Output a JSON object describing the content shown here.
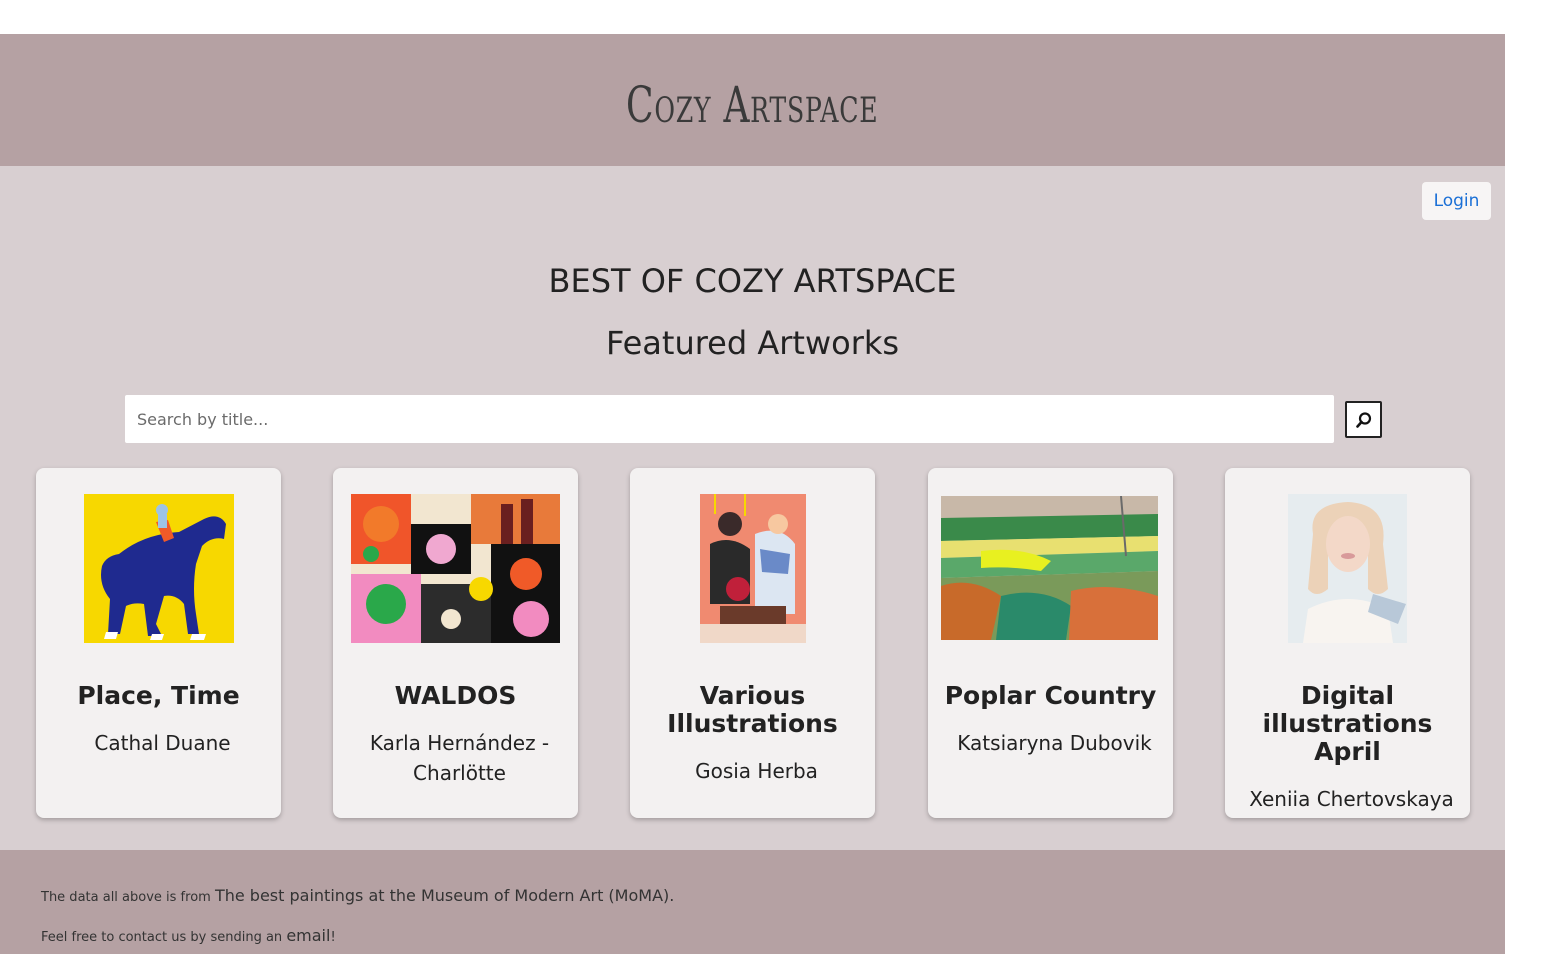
{
  "header": {
    "brand": "Cozy Artspace"
  },
  "nav": {
    "login_label": "Login"
  },
  "main": {
    "heading": "BEST OF COZY ARTSPACE",
    "subheading": "Featured Artworks",
    "search": {
      "placeholder": "Search by title...",
      "value": ""
    }
  },
  "cards": [
    {
      "title": "Place, Time",
      "artist": "Cathal Duane"
    },
    {
      "title": "WALDOS",
      "artist": "Karla Hernández - Charlötte"
    },
    {
      "title": "Various Illustrations",
      "artist": "Gosia Herba"
    },
    {
      "title": "Poplar Country",
      "artist": "Katsiaryna Dubovik"
    },
    {
      "title": "Digital illustrations April",
      "artist": "Xeniia Chertovskaya"
    }
  ],
  "footer": {
    "line1_prefix": "The data all above is from",
    "line1_link": "The best paintings at the Museum of Modern Art (MoMA).",
    "line2_prefix": "Feel free to contact us by sending an",
    "line2_link": "email",
    "line2_suffix": "!"
  }
}
